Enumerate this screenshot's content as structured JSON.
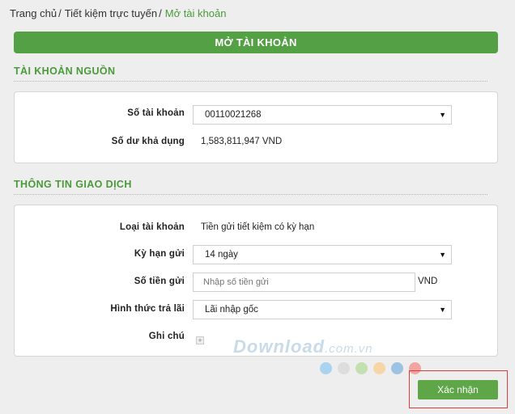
{
  "breadcrumb": {
    "home": "Trang chủ",
    "parent": "Tiết kiệm trực tuyến",
    "current": "Mở tài khoản",
    "separator": "/"
  },
  "page_title": "MỞ TÀI KHOẢN",
  "source_account": {
    "heading": "TÀI KHOẢN NGUỒN",
    "account_label": "Số tài khoản",
    "account_value": "00110021268",
    "balance_label": "Số dư khả dụng",
    "balance_value": "1,583,811,947 VND"
  },
  "transaction": {
    "heading": "THÔNG TIN GIAO DỊCH",
    "account_type_label": "Loại tài khoản",
    "account_type_value": "Tiền gửi tiết kiệm có kỳ hạn",
    "term_label": "Kỳ hạn gửi",
    "term_value": "14 ngày",
    "amount_label": "Số tiền gửi",
    "amount_placeholder": "Nhập số tiền gửi",
    "amount_currency": "VND",
    "interest_label": "Hình thức trả lãi",
    "interest_value": "Lãi nhập gốc",
    "note_label": "Ghi chú"
  },
  "watermark": {
    "main": "Download",
    "suffix": ".com.vn"
  },
  "dot_colors": [
    "#a9d3ee",
    "#dddddd",
    "#c2e0b0",
    "#f6d6a6",
    "#9dc3e3",
    "#f4a3a3"
  ],
  "confirm_label": "Xác nhận",
  "colors": {
    "accent": "#54a044",
    "heading": "#4a9a3a",
    "highlight_frame": "#e03a3a"
  }
}
